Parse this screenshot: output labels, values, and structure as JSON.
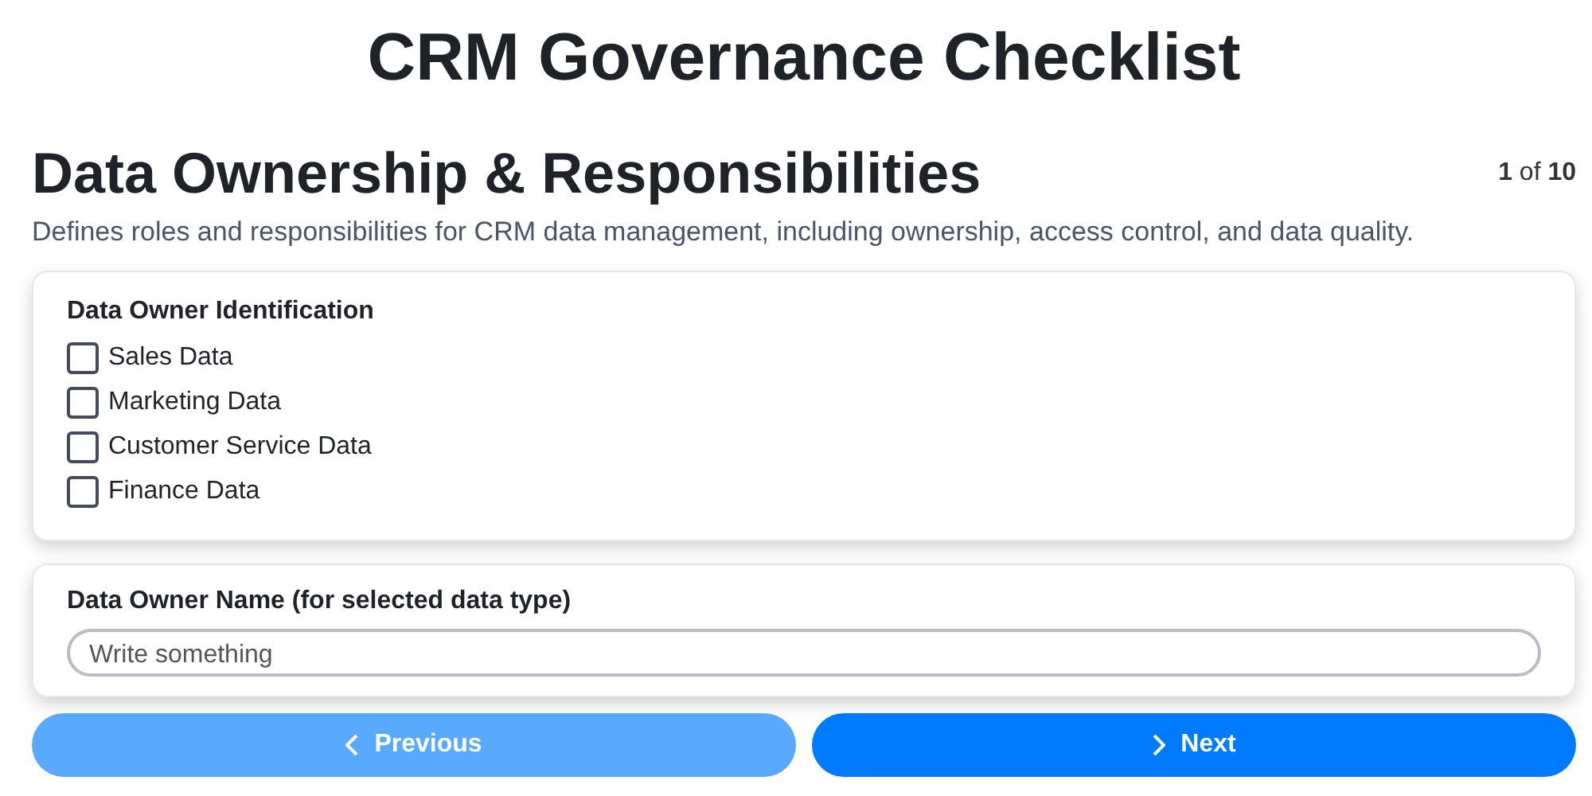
{
  "page_title": "CRM Governance Checklist",
  "section": {
    "title": "Data Ownership & Responsibilities",
    "counter": "**1** of **10**",
    "description": "Defines roles and responsibilities for CRM data management, including ownership, access control, and data quality."
  },
  "questions": [
    {
      "kind": "checklist",
      "label": "Data Owner Identification",
      "options": [
        {
          "label": "Sales Data",
          "checked": false
        },
        {
          "label": "Marketing Data",
          "checked": false
        },
        {
          "label": "Customer Service Data",
          "checked": false
        },
        {
          "label": "Finance Data",
          "checked": false
        }
      ]
    },
    {
      "kind": "text",
      "label": "Data Owner Name (for selected data type)",
      "placeholder": "Write something"
    }
  ],
  "nav": [
    {
      "kind": "previous",
      "label": "Previous",
      "disabled": true
    },
    {
      "kind": "next",
      "label": "Next",
      "disabled": false
    }
  ]
}
